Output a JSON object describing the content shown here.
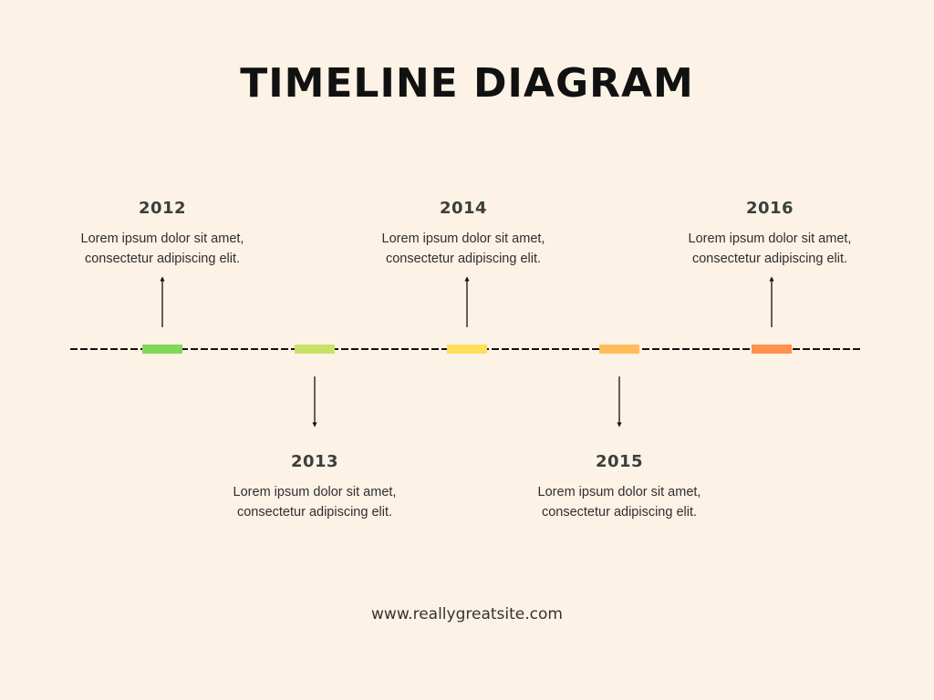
{
  "title": "TIMELINE DIAGRAM",
  "events": [
    {
      "year": "2012",
      "line1": "Lorem ipsum dolor sit amet,",
      "line2": "consectetur adipiscing elit.",
      "color": "#7ed957",
      "position": "above"
    },
    {
      "year": "2013",
      "line1": "Lorem ipsum dolor sit amet,",
      "line2": "consectetur adipiscing elit.",
      "color": "#c9e265",
      "position": "below"
    },
    {
      "year": "2014",
      "line1": "Lorem ipsum dolor sit amet,",
      "line2": "consectetur adipiscing elit.",
      "color": "#ffde59",
      "position": "above"
    },
    {
      "year": "2015",
      "line1": "Lorem ipsum dolor sit amet,",
      "line2": "consectetur adipiscing elit.",
      "color": "#ffbd59",
      "position": "below"
    },
    {
      "year": "2016",
      "line1": "Lorem ipsum dolor sit amet,",
      "line2": "consectetur adipiscing elit.",
      "color": "#ff914d",
      "position": "above"
    }
  ],
  "footer": "www.reallygreatsite.com"
}
